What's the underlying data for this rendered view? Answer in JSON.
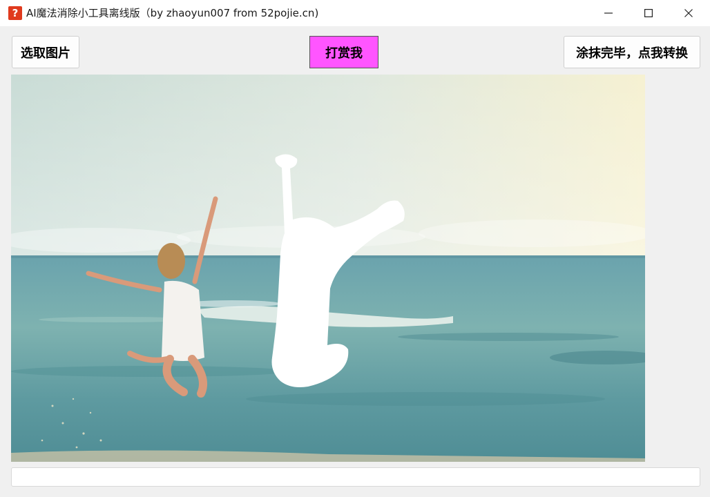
{
  "window": {
    "title": "AI魔法消除小工具离线版（by zhaoyun007 from 52pojie.cn)",
    "icon": "question-mark-icon",
    "icon_glyph": "?",
    "controls": {
      "minimize_icon": "minimize-icon",
      "maximize_icon": "maximize-icon",
      "close_icon": "close-icon"
    }
  },
  "toolbar": {
    "select_image_label": "选取图片",
    "donate_label": "打赏我",
    "convert_label": "涂抹完毕，点我转换"
  },
  "colors": {
    "donate_button": "#ff55ff",
    "mask": "#ffffff",
    "sky": "#dfe8e0",
    "sea": "#5e9ca2"
  },
  "status": {
    "text": ""
  }
}
